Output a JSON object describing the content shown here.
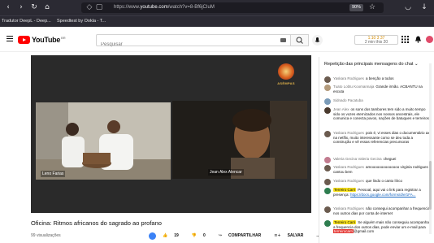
{
  "browser": {
    "url_prefix": "https://www.",
    "url_domain": "youtube.com",
    "url_path": "/watch?v=8-Bf6jCIuM",
    "zoom": "90%",
    "bookmarks": [
      "Tradutor DeepL - Deep...",
      "Speedtest by Ookla - T..."
    ]
  },
  "header": {
    "logo_text": "YouTube",
    "logo_country": "BR",
    "search_placeholder": "Pesquisar",
    "ext_line1": "1:10  3  37",
    "ext_line2": "2 min  this  20"
  },
  "video": {
    "channel_logo_text": "ASÈMPAS",
    "participants": [
      {
        "label": "Leno Farias"
      },
      {
        "label": "Jean Alex Alencar"
      }
    ]
  },
  "below": {
    "title": "Oficina: Ritmos africanos do sagrado ao profano",
    "views": "99 visualizações",
    "likes": "19",
    "dislikes": "0",
    "share_label": "COMPARTILHAR",
    "save_label": "SALVAR",
    "more": "..."
  },
  "chat": {
    "header": "Repetição das principais mensagens do chat",
    "messages": [
      {
        "author": "Yaskara Rodrigues",
        "text": "a benção a todos",
        "member": false
      },
      {
        "author": "Tuato Lobtu Koomannaja",
        "text": "Grande irmão. ACBANTU na escuta",
        "member": false
      },
      {
        "author": "Sidnado Pacatuba",
        "text": "",
        "member": false
      },
      {
        "author": "Jean Alex",
        "text": "os sons dos tambores tem sido a muito tempo sido os vozes eternizados nos nossos ancestrais, ele comunica e conecta povos, nações de batuques e terreiros.",
        "member": false
      },
      {
        "author": "Yaskara Rodrigues",
        "text": "pois é, vi esses dias o documentário axé na netflix, muito interessante como se deu toda a construção e vê essas referencias precursoras",
        "member": false
      },
      {
        "author": "Valeria Gecina Valeria Gecina",
        "text": "cheguei",
        "member": false
      },
      {
        "author": "Yaskara Rodrigues",
        "text": "amoooooooooooooo virginia rodrigues cantou bem",
        "member": false
      },
      {
        "author": "Yaskara Rodrigues",
        "text": "que lindo o canto lírico",
        "member": false
      },
      {
        "author": "Terreiro Carri",
        "text": "Pessoal, aqui vai o link para registrar a presença: ",
        "link": "https://docs.google.com/forms/d/e/1FA...",
        "member": true
      },
      {
        "author": "Yaskara Rodrigues",
        "text": "não consegui acompanhar a frequencia nos outros dias por conta de internet",
        "member": false
      },
      {
        "author": "Terreiro Carri",
        "text": "Se alguém mais não conseguiu acompanhar a frequencia dos outros dias, pode enviar um e-mail para ",
        "red": "terreirocarri",
        "tail": "@gmail.com",
        "member": true
      }
    ]
  }
}
